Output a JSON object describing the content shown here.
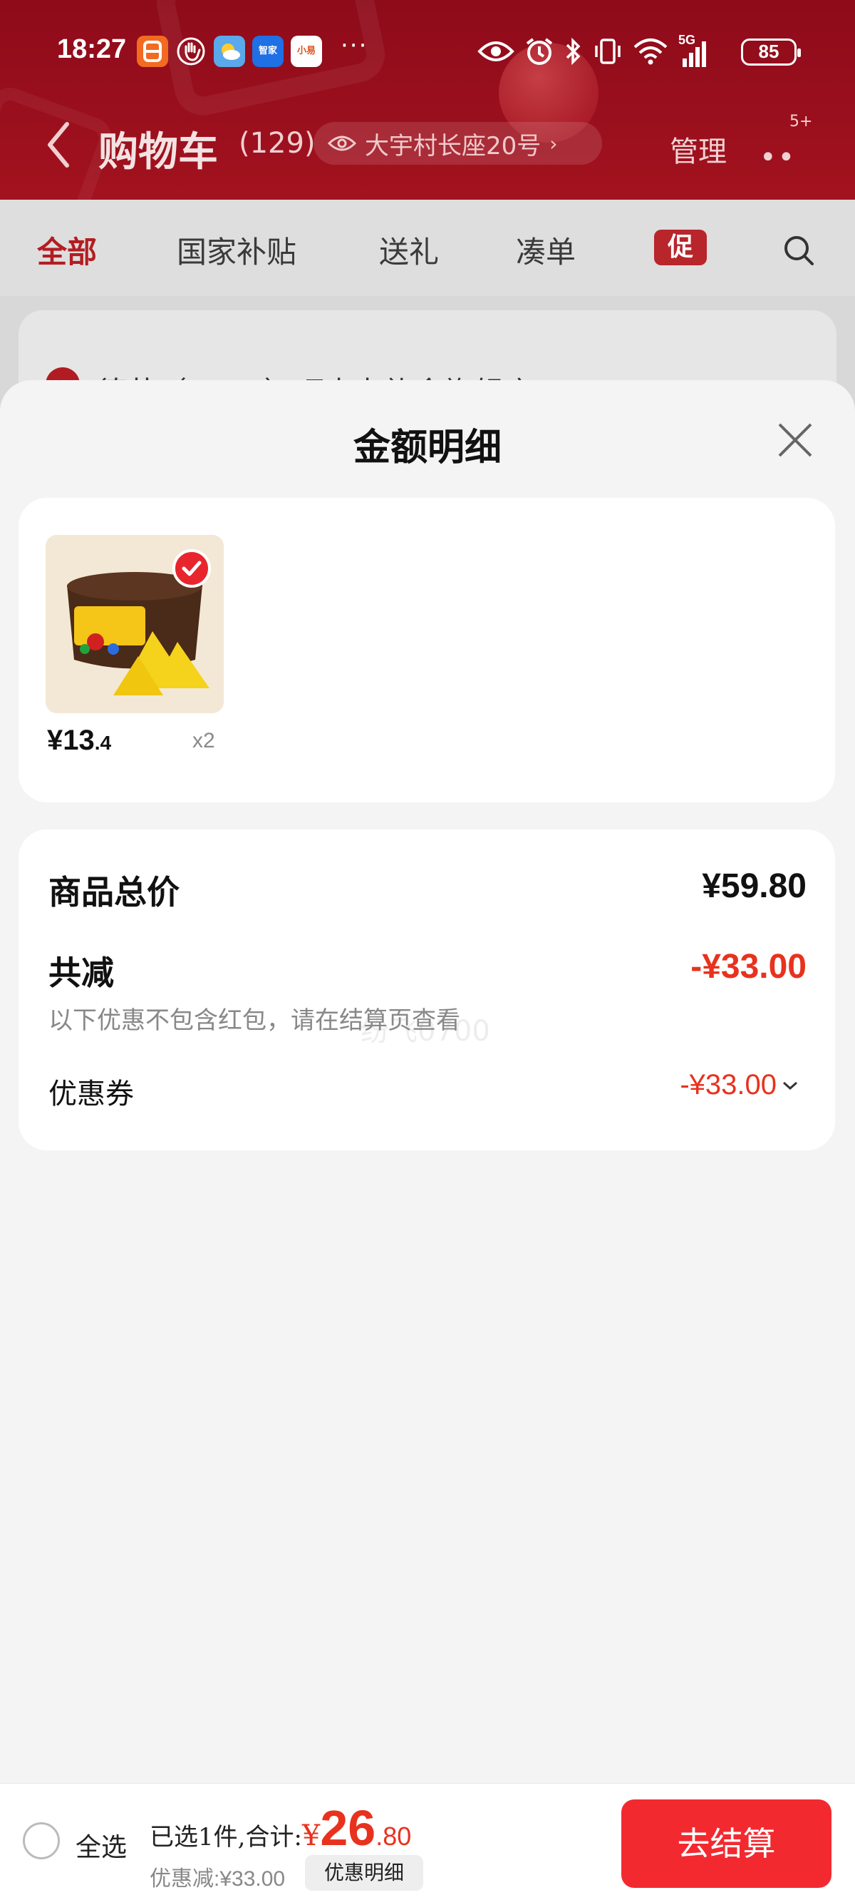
{
  "status_bar": {
    "time": "18:27",
    "apps": [
      {
        "name": "app-icon-1",
        "label": "",
        "color": "#f26b21"
      },
      {
        "name": "app-icon-2",
        "label": "",
        "color": "#e53935"
      },
      {
        "name": "weather-app-icon",
        "label": "",
        "color": "#4fa3e6"
      },
      {
        "name": "haier-app-icon",
        "label": "智家",
        "color": "#1f6fe5"
      },
      {
        "name": "xiaomi-app-icon",
        "label": "小易",
        "color": "#f5a623"
      }
    ],
    "more": "···",
    "network": "5G",
    "battery": "85"
  },
  "header": {
    "title": "购物车",
    "count": "(129)",
    "address": "大宇村长座20号",
    "manage": "管理",
    "more_badge": "5+"
  },
  "tabs": [
    "全部",
    "国家补贴",
    "送礼",
    "凑单"
  ],
  "promo_tab": "促",
  "underlay_store": "德芙（Dove）巧克力礼盒旗舰店 ›",
  "sheet": {
    "title": "金额明细",
    "product": {
      "price_int": "¥13",
      "price_dec": ".4",
      "qty": "x2"
    },
    "summary": {
      "total_label": "商品总价",
      "total_value": "¥59.80",
      "discount_label": "共减",
      "discount_value": "-¥33.00",
      "note": "以下优惠不包含红包，请在结算页查看",
      "coupon_label": "优惠券",
      "coupon_value": "-¥33.00"
    },
    "watermark": "纷飞0700"
  },
  "bottom_bar": {
    "select_all": "全选",
    "selected_text": "已选1件,合计:",
    "currency": "¥",
    "total_int": "26",
    "total_dec": ".80",
    "discount_text": "优惠减:¥33.00",
    "detail_button": "优惠明细",
    "checkout": "去结算"
  },
  "colors": {
    "header_red": "#9c1220",
    "accent_red": "#e8321e",
    "checkout_red": "#f22a30"
  }
}
